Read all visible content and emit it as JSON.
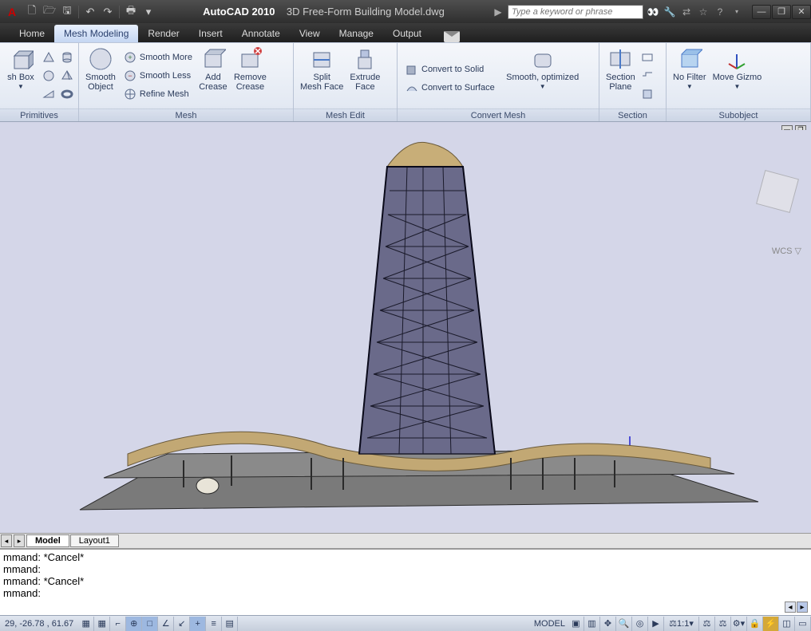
{
  "titlebar": {
    "app": "AutoCAD 2010",
    "doc": "3D Free-Form Building Model.dwg",
    "search_placeholder": "Type a keyword or phrase"
  },
  "tabs": [
    {
      "label": "Home"
    },
    {
      "label": "Mesh Modeling"
    },
    {
      "label": "Render"
    },
    {
      "label": "Insert"
    },
    {
      "label": "Annotate"
    },
    {
      "label": "View"
    },
    {
      "label": "Manage"
    },
    {
      "label": "Output"
    }
  ],
  "ribbon": {
    "primitives": {
      "title": "Primitives",
      "mesh_box": "sh Box"
    },
    "mesh": {
      "title": "Mesh",
      "smooth_object": "Smooth\nObject",
      "smooth_more": "Smooth More",
      "smooth_less": "Smooth Less",
      "refine": "Refine Mesh",
      "add_crease": "Add\nCrease",
      "remove_crease": "Remove\nCrease"
    },
    "mesh_edit": {
      "title": "Mesh Edit",
      "split": "Split\nMesh Face",
      "extrude": "Extrude\nFace"
    },
    "convert": {
      "title": "Convert Mesh",
      "to_solid": "Convert to Solid",
      "to_surface": "Convert to Surface",
      "smooth_opt": "Smooth, optimized"
    },
    "section": {
      "title": "Section",
      "plane": "Section\nPlane"
    },
    "subobject": {
      "title": "Subobject",
      "no_filter": "No Filter",
      "move_gizmo": "Move Gizmo"
    }
  },
  "viewport": {
    "wcs": "WCS"
  },
  "bottom_tabs": {
    "model": "Model",
    "layout": "Layout1"
  },
  "cmd": {
    "l1": "mmand: *Cancel*",
    "l2": "mmand:",
    "l3": "mmand: *Cancel*",
    "l4": "mmand:"
  },
  "status": {
    "coords": "29,  -26.78 , 61.67",
    "model": "MODEL",
    "ann": "1:1"
  }
}
